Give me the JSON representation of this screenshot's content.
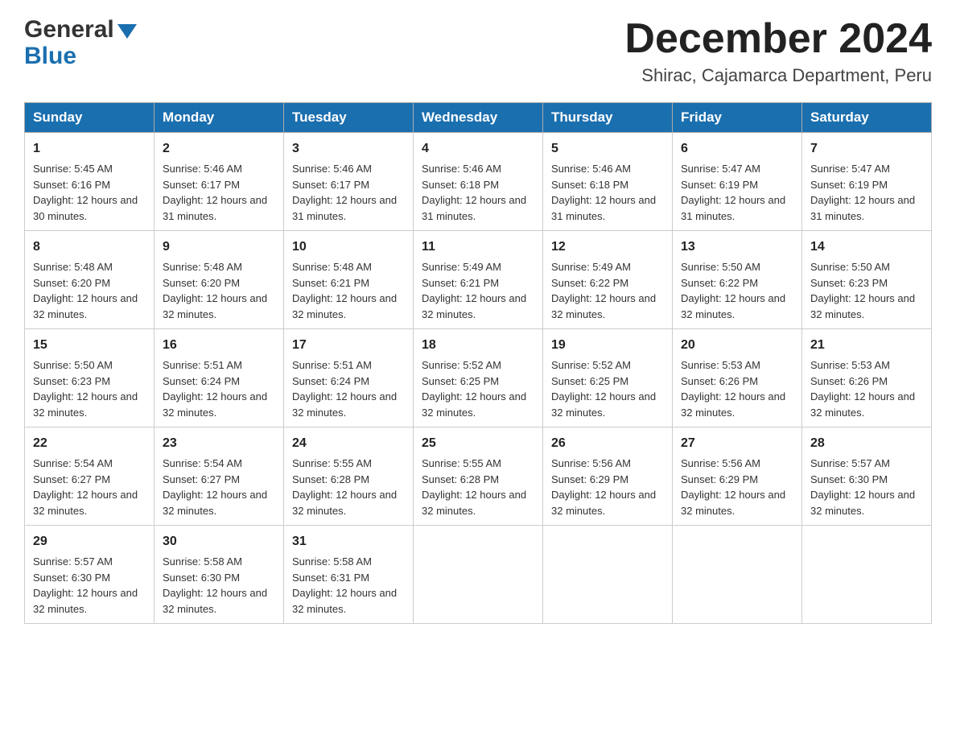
{
  "header": {
    "logo_general": "General",
    "logo_blue": "Blue",
    "month_title": "December 2024",
    "location": "Shirac, Cajamarca Department, Peru"
  },
  "weekdays": [
    "Sunday",
    "Monday",
    "Tuesday",
    "Wednesday",
    "Thursday",
    "Friday",
    "Saturday"
  ],
  "weeks": [
    [
      {
        "day": "1",
        "sunrise": "5:45 AM",
        "sunset": "6:16 PM",
        "daylight": "12 hours and 30 minutes."
      },
      {
        "day": "2",
        "sunrise": "5:46 AM",
        "sunset": "6:17 PM",
        "daylight": "12 hours and 31 minutes."
      },
      {
        "day": "3",
        "sunrise": "5:46 AM",
        "sunset": "6:17 PM",
        "daylight": "12 hours and 31 minutes."
      },
      {
        "day": "4",
        "sunrise": "5:46 AM",
        "sunset": "6:18 PM",
        "daylight": "12 hours and 31 minutes."
      },
      {
        "day": "5",
        "sunrise": "5:46 AM",
        "sunset": "6:18 PM",
        "daylight": "12 hours and 31 minutes."
      },
      {
        "day": "6",
        "sunrise": "5:47 AM",
        "sunset": "6:19 PM",
        "daylight": "12 hours and 31 minutes."
      },
      {
        "day": "7",
        "sunrise": "5:47 AM",
        "sunset": "6:19 PM",
        "daylight": "12 hours and 31 minutes."
      }
    ],
    [
      {
        "day": "8",
        "sunrise": "5:48 AM",
        "sunset": "6:20 PM",
        "daylight": "12 hours and 32 minutes."
      },
      {
        "day": "9",
        "sunrise": "5:48 AM",
        "sunset": "6:20 PM",
        "daylight": "12 hours and 32 minutes."
      },
      {
        "day": "10",
        "sunrise": "5:48 AM",
        "sunset": "6:21 PM",
        "daylight": "12 hours and 32 minutes."
      },
      {
        "day": "11",
        "sunrise": "5:49 AM",
        "sunset": "6:21 PM",
        "daylight": "12 hours and 32 minutes."
      },
      {
        "day": "12",
        "sunrise": "5:49 AM",
        "sunset": "6:22 PM",
        "daylight": "12 hours and 32 minutes."
      },
      {
        "day": "13",
        "sunrise": "5:50 AM",
        "sunset": "6:22 PM",
        "daylight": "12 hours and 32 minutes."
      },
      {
        "day": "14",
        "sunrise": "5:50 AM",
        "sunset": "6:23 PM",
        "daylight": "12 hours and 32 minutes."
      }
    ],
    [
      {
        "day": "15",
        "sunrise": "5:50 AM",
        "sunset": "6:23 PM",
        "daylight": "12 hours and 32 minutes."
      },
      {
        "day": "16",
        "sunrise": "5:51 AM",
        "sunset": "6:24 PM",
        "daylight": "12 hours and 32 minutes."
      },
      {
        "day": "17",
        "sunrise": "5:51 AM",
        "sunset": "6:24 PM",
        "daylight": "12 hours and 32 minutes."
      },
      {
        "day": "18",
        "sunrise": "5:52 AM",
        "sunset": "6:25 PM",
        "daylight": "12 hours and 32 minutes."
      },
      {
        "day": "19",
        "sunrise": "5:52 AM",
        "sunset": "6:25 PM",
        "daylight": "12 hours and 32 minutes."
      },
      {
        "day": "20",
        "sunrise": "5:53 AM",
        "sunset": "6:26 PM",
        "daylight": "12 hours and 32 minutes."
      },
      {
        "day": "21",
        "sunrise": "5:53 AM",
        "sunset": "6:26 PM",
        "daylight": "12 hours and 32 minutes."
      }
    ],
    [
      {
        "day": "22",
        "sunrise": "5:54 AM",
        "sunset": "6:27 PM",
        "daylight": "12 hours and 32 minutes."
      },
      {
        "day": "23",
        "sunrise": "5:54 AM",
        "sunset": "6:27 PM",
        "daylight": "12 hours and 32 minutes."
      },
      {
        "day": "24",
        "sunrise": "5:55 AM",
        "sunset": "6:28 PM",
        "daylight": "12 hours and 32 minutes."
      },
      {
        "day": "25",
        "sunrise": "5:55 AM",
        "sunset": "6:28 PM",
        "daylight": "12 hours and 32 minutes."
      },
      {
        "day": "26",
        "sunrise": "5:56 AM",
        "sunset": "6:29 PM",
        "daylight": "12 hours and 32 minutes."
      },
      {
        "day": "27",
        "sunrise": "5:56 AM",
        "sunset": "6:29 PM",
        "daylight": "12 hours and 32 minutes."
      },
      {
        "day": "28",
        "sunrise": "5:57 AM",
        "sunset": "6:30 PM",
        "daylight": "12 hours and 32 minutes."
      }
    ],
    [
      {
        "day": "29",
        "sunrise": "5:57 AM",
        "sunset": "6:30 PM",
        "daylight": "12 hours and 32 minutes."
      },
      {
        "day": "30",
        "sunrise": "5:58 AM",
        "sunset": "6:30 PM",
        "daylight": "12 hours and 32 minutes."
      },
      {
        "day": "31",
        "sunrise": "5:58 AM",
        "sunset": "6:31 PM",
        "daylight": "12 hours and 32 minutes."
      },
      null,
      null,
      null,
      null
    ]
  ]
}
